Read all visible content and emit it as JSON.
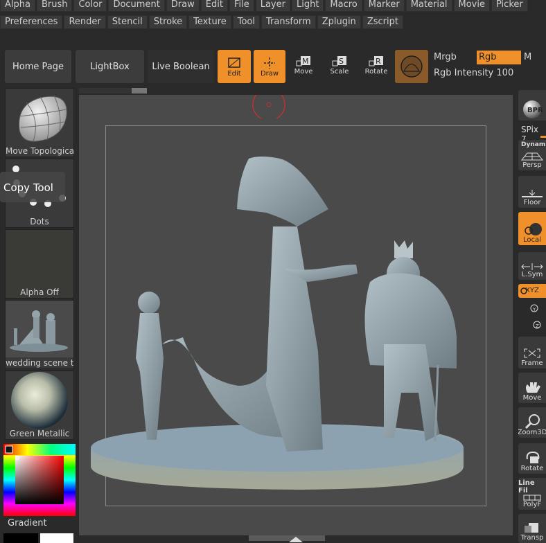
{
  "menu_row1": [
    "Alpha",
    "Brush",
    "Color",
    "Document",
    "Draw",
    "Edit",
    "File",
    "Layer",
    "Light",
    "Macro",
    "Marker",
    "Material",
    "Movie",
    "Picker"
  ],
  "menu_row2": [
    "Preferences",
    "Render",
    "Stencil",
    "Stroke",
    "Texture",
    "Tool",
    "Transform",
    "Zplugin",
    "Zscript"
  ],
  "toolbar": {
    "home_page": "Home Page",
    "lightbox": "LightBox",
    "live_boolean": "Live Boolean",
    "edit": "Edit",
    "draw": "Draw",
    "move": "Move",
    "scale": "Scale",
    "rotate": "Rotate",
    "mrgb": "Mrgb",
    "rgb": "Rgb",
    "m": "M",
    "rgb_intensity_label": "Rgb Intensity",
    "rgb_intensity_value": "100"
  },
  "left_shelf": {
    "brush_caption": "Move Topologica",
    "tooltip": "Copy Tool",
    "stroke_caption": "Dots",
    "alpha_caption": "Alpha Off",
    "tool_caption": "wedding scene t",
    "material_caption": "Green Metallic",
    "gradient_label": "Gradient"
  },
  "right_shelf": {
    "bpr": "BPR",
    "spix_label": "SPix",
    "spix_value": "7",
    "dynamic": "Dynami",
    "persp": "Persp",
    "floor": "Floor",
    "local": "Local",
    "lsym": "L.Sym",
    "xyz": "XYZ",
    "frame": "Frame",
    "move": "Move",
    "zoom3d": "Zoom3D",
    "rotate": "Rotate",
    "line_fill": "Line Fil",
    "polyf": "PolyF",
    "transp": "Transp"
  },
  "colors": {
    "accent_orange": "#f0902a",
    "panel_bg": "#3a3a3a",
    "canvas_bg": "#4a4a4a",
    "model_color": "#8a9aa3"
  },
  "icons": [
    "move-icon",
    "scale-icon",
    "rotate-icon",
    "edit-icon",
    "draw-icon",
    "material-sphere-icon",
    "bpr-icon",
    "persp-icon",
    "floor-icon",
    "local-icon",
    "lsym-icon",
    "xyz-icon",
    "rotate-y-icon",
    "rotate-z-icon",
    "frame-icon",
    "move-hand-icon",
    "zoom3d-icon",
    "rotate-view-icon",
    "polyf-icon",
    "transp-icon"
  ]
}
